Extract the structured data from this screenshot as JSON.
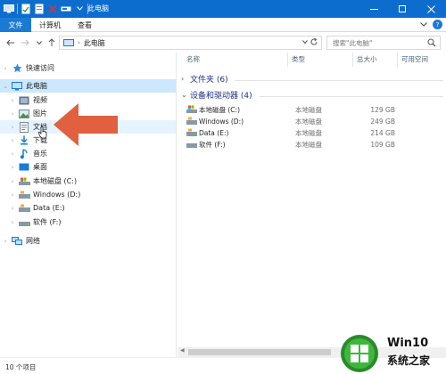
{
  "window": {
    "title": "此电脑",
    "controls": {
      "minimize": "minimize",
      "maximize": "maximize",
      "close": "close"
    }
  },
  "ribbon": {
    "tabs": [
      {
        "label": "文件",
        "active": true
      },
      {
        "label": "计算机",
        "active": false
      },
      {
        "label": "查看",
        "active": false
      }
    ]
  },
  "address": {
    "path": [
      "此电脑"
    ],
    "search_placeholder": "搜索\"此电脑\""
  },
  "nav": {
    "items": [
      {
        "label": "快速访问",
        "icon": "star-icon",
        "expandable": true,
        "indent": 0,
        "state": ""
      },
      {
        "label": "此电脑",
        "icon": "computer-icon",
        "expandable": true,
        "expanded": true,
        "indent": 0,
        "state": "selected"
      },
      {
        "label": "视频",
        "icon": "video-folder-icon",
        "expandable": true,
        "indent": 1,
        "state": ""
      },
      {
        "label": "图片",
        "icon": "pictures-folder-icon",
        "expandable": true,
        "indent": 1,
        "state": ""
      },
      {
        "label": "文档",
        "icon": "documents-folder-icon",
        "expandable": true,
        "indent": 1,
        "state": "hover"
      },
      {
        "label": "下载",
        "icon": "downloads-folder-icon",
        "expandable": true,
        "indent": 1,
        "state": ""
      },
      {
        "label": "音乐",
        "icon": "music-folder-icon",
        "expandable": true,
        "indent": 1,
        "state": ""
      },
      {
        "label": "桌面",
        "icon": "desktop-folder-icon",
        "expandable": true,
        "indent": 1,
        "state": ""
      },
      {
        "label": "本地磁盘 (C:)",
        "icon": "system-drive-icon",
        "expandable": true,
        "indent": 1,
        "state": ""
      },
      {
        "label": "Windows (D:)",
        "icon": "drive-icon",
        "expandable": true,
        "indent": 1,
        "state": ""
      },
      {
        "label": "Data (E:)",
        "icon": "drive-icon",
        "expandable": true,
        "indent": 1,
        "state": ""
      },
      {
        "label": "软件 (F:)",
        "icon": "drive-icon",
        "expandable": true,
        "indent": 1,
        "state": ""
      },
      {
        "label": "网络",
        "icon": "network-icon",
        "expandable": true,
        "indent": 0,
        "state": ""
      }
    ]
  },
  "content": {
    "columns": [
      "名称",
      "类型",
      "总大小",
      "可用空间"
    ],
    "groups": [
      {
        "label": "文件夹 (6)",
        "expanded": false
      },
      {
        "label": "设备和驱动器 (4)",
        "expanded": true
      }
    ],
    "drives": [
      {
        "name": "本地磁盘 (C:)",
        "type": "本地磁盘",
        "size": "129 GB",
        "icon": "system-drive-icon"
      },
      {
        "name": "Windows (D:)",
        "type": "本地磁盘",
        "size": "249 GB",
        "icon": "drive-icon"
      },
      {
        "name": "Data (E:)",
        "type": "本地磁盘",
        "size": "214 GB",
        "icon": "drive-icon"
      },
      {
        "name": "软件 (F:)",
        "type": "本地磁盘",
        "size": "109 GB",
        "icon": "drive-icon"
      }
    ]
  },
  "status": {
    "text": "10 个项目"
  },
  "annotation": {
    "arrow_color": "#e06040",
    "target": "文档"
  },
  "watermark": {
    "title": "Win10",
    "subtitle": "系统之家"
  },
  "colors": {
    "titlebar": "#0d6dcf",
    "accent": "#1b7ad6",
    "selection": "#cce8ff",
    "group_text": "#1e3287"
  }
}
